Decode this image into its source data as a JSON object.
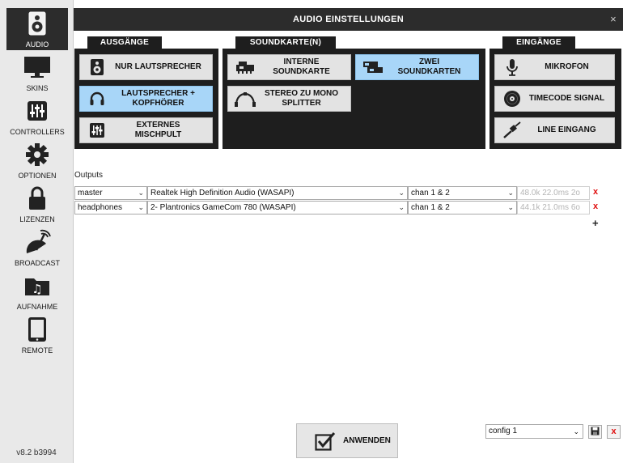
{
  "sidebar": {
    "items": [
      {
        "label": "AUDIO",
        "icon": "speaker-icon"
      },
      {
        "label": "SKINS",
        "icon": "monitor-icon"
      },
      {
        "label": "CONTROLLERS",
        "icon": "sliders-icon"
      },
      {
        "label": "OPTIONEN",
        "icon": "gear-icon"
      },
      {
        "label": "LIZENZEN",
        "icon": "lock-icon"
      },
      {
        "label": "BROADCAST",
        "icon": "broadcast-icon"
      },
      {
        "label": "AUFNAHME",
        "icon": "music-folder-icon"
      },
      {
        "label": "REMOTE",
        "icon": "tablet-icon"
      }
    ],
    "version": "v8.2 b3994"
  },
  "dialog": {
    "title": "AUDIO EINSTELLUNGEN",
    "close": "×"
  },
  "groups": {
    "ausgaenge": {
      "title": "AUSGÄNGE",
      "buttons": [
        {
          "label": "NUR LAUTSPRECHER",
          "icon": "speaker-icon"
        },
        {
          "label": "LAUTSPRECHER +\nKOPFHÖRER",
          "icon": "headphones-icon",
          "selected": true
        },
        {
          "label": "EXTERNES\nMISCHPULT",
          "icon": "mixer-icon"
        }
      ]
    },
    "soundkarte": {
      "title": "SOUNDKARTE(N)",
      "buttons": [
        {
          "label": "INTERNE\nSOUNDKARTE",
          "icon": "soundcard-icon"
        },
        {
          "label": "ZWEI\nSOUNDKARTEN",
          "icon": "dual-soundcard-icon",
          "selected": true
        },
        {
          "label": "STEREO ZU MONO\nSPLITTER",
          "icon": "splitter-cable-icon"
        }
      ]
    },
    "eingaenge": {
      "title": "EINGÄNGE",
      "buttons": [
        {
          "label": "MIKROFON",
          "icon": "microphone-icon"
        },
        {
          "label": "TIMECODE SIGNAL",
          "icon": "vinyl-icon"
        },
        {
          "label": "LINE EINGANG",
          "icon": "jack-cable-icon"
        }
      ]
    }
  },
  "outputs": {
    "label": "Outputs",
    "rows": [
      {
        "channel": "master",
        "device": "Realtek High Definition Audio (WASAPI)",
        "chan": "chan 1 & 2",
        "info": "48.0k 22.0ms 2o"
      },
      {
        "channel": "headphones",
        "device": "2- Plantronics GameCom 780 (WASAPI)",
        "chan": "chan 1 & 2",
        "info": "44.1k 21.0ms 6o"
      }
    ],
    "delete": "x",
    "add": "+"
  },
  "footer": {
    "apply_label": "ANWENDEN",
    "config_value": "config 1",
    "chevron": "⌄"
  }
}
